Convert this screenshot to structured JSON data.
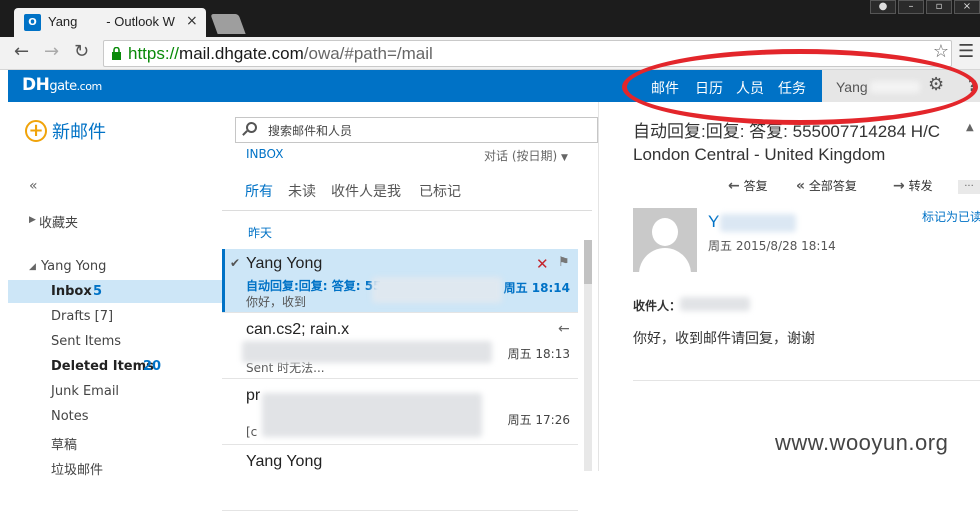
{
  "browser": {
    "tab_title": "Yang        - Outlook W",
    "tab_icon": "outlook-icon",
    "tab_close": "×",
    "url_scheme": "https://",
    "url_host": "mail.dhgate.com",
    "url_path": "/owa/#path=/mail"
  },
  "header": {
    "logo_dh": "DH",
    "logo_gate": "gate",
    "logo_dom": ".com",
    "nav": [
      "邮件",
      "日历",
      "人员",
      "任务"
    ],
    "user_name": "Yang",
    "gear": "⚙",
    "help": "?"
  },
  "left": {
    "new_mail": "新邮件",
    "collapse": "«",
    "favorites": "收藏夹",
    "account": "Yang Yong",
    "folders": [
      {
        "label": "Inbox",
        "count": "5"
      },
      {
        "label": "Drafts [7]"
      },
      {
        "label": "Sent Items"
      },
      {
        "label": "Deleted Items",
        "count": "20"
      },
      {
        "label": "Junk Email"
      },
      {
        "label": "Notes"
      },
      {
        "label": "草稿"
      },
      {
        "label": "垃圾邮件"
      }
    ]
  },
  "middle": {
    "search_placeholder": "搜索邮件和人员",
    "folder": "INBOX",
    "sort": "对话 (按日期)",
    "filters": [
      "所有",
      "未读",
      "收件人是我",
      "已标记"
    ],
    "day_header": "昨天",
    "messages": [
      {
        "from": "Yang Yong",
        "subject": "自动回复:回复: 答复: 55",
        "preview": "你好，收到",
        "time": "周五 18:14",
        "selected": true
      },
      {
        "from": "can.cs2; rain.x",
        "subject": "",
        "preview": "Sent                 时无法...",
        "time": "周五 18:13",
        "selected": false
      },
      {
        "from": "pr",
        "subject": "",
        "preview": "[c",
        "time": "周五 17:26",
        "selected": false
      },
      {
        "from": "Yang Yong",
        "subject": "",
        "preview": "",
        "time": "",
        "selected": false
      }
    ]
  },
  "reading": {
    "subject": "自动回复:回复: 答复: 555007714284 H/C London Central - United Kingdom",
    "actions": [
      "答复",
      "全部答复",
      "转发"
    ],
    "more": "...",
    "sender": "Y",
    "date": "周五 2015/8/28 18:14",
    "mark_read": "标记为已读",
    "to_label": "收件人：",
    "body": "你好，收到邮件请回复，谢谢"
  },
  "watermark": "www.wooyun.org"
}
